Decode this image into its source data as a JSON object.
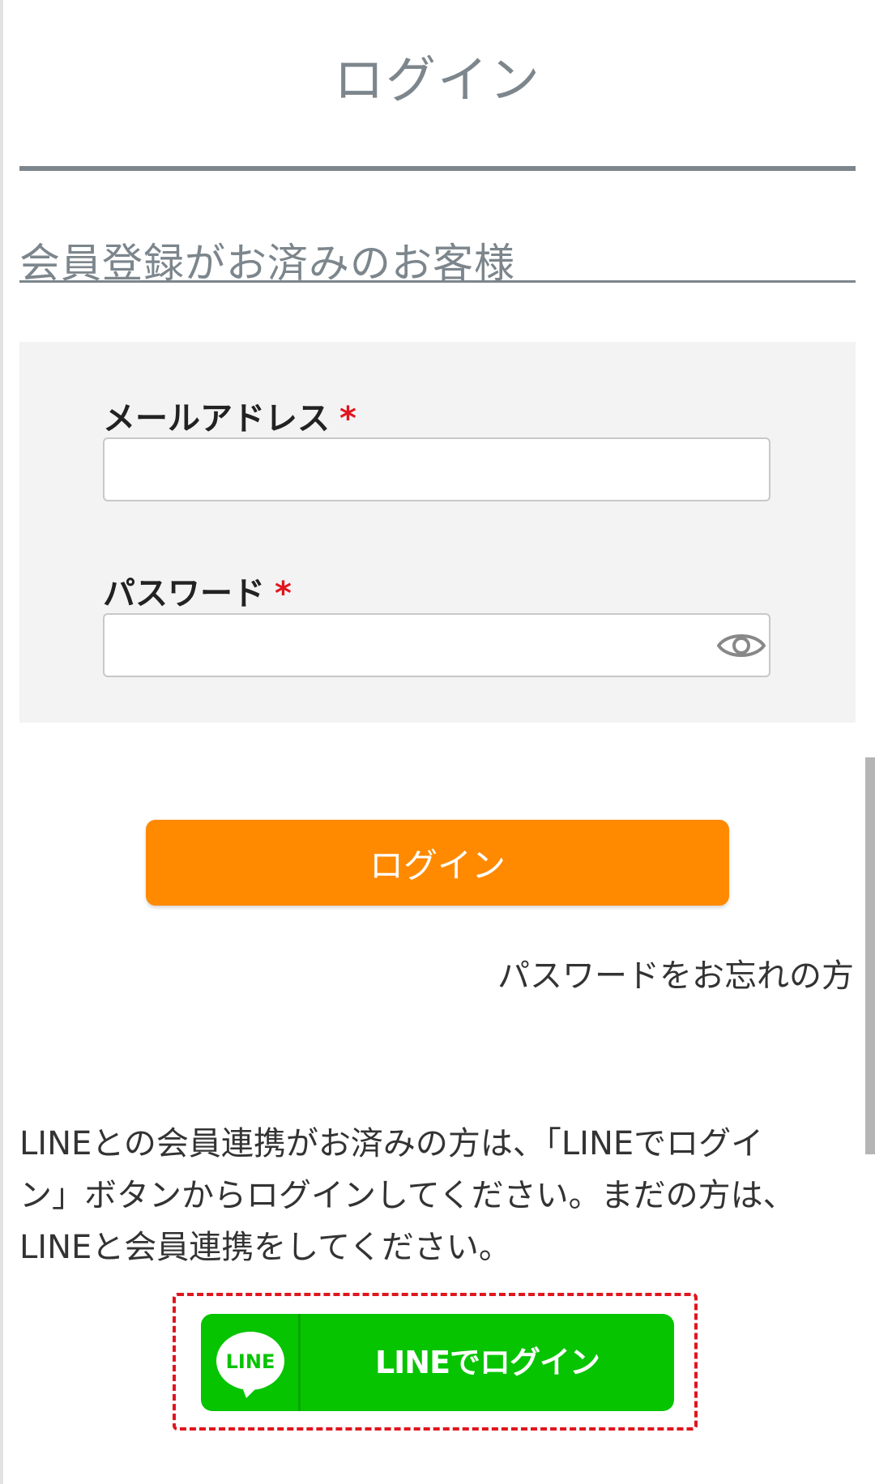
{
  "page": {
    "title": "ログイン"
  },
  "section": {
    "heading": "会員登録がお済みのお客様"
  },
  "form": {
    "email_label": "メールアドレス",
    "email_value": "",
    "password_label": "パスワード",
    "password_value": "",
    "required_mark": "*",
    "submit_label": "ログイン",
    "forgot_password_link": "パスワードをお忘れの方"
  },
  "line": {
    "notice_line1": "LINEとの会員連携がお済みの方は、「LINEでログイ",
    "notice_line2": "ン」ボタンからログインしてください。まだの方は、",
    "notice_line3": "LINEと会員連携をしてください。",
    "logo_text": "LINE",
    "button_label": "LINEでログイン"
  },
  "colors": {
    "accent_orange": "#ff8a00",
    "line_green": "#06c400",
    "heading_gray": "#7c868c",
    "required_red": "#e0161f",
    "highlight_frame_red": "#e0161f"
  },
  "icons": {
    "password_toggle": "eye-icon",
    "line_logo": "line-logo-icon"
  }
}
